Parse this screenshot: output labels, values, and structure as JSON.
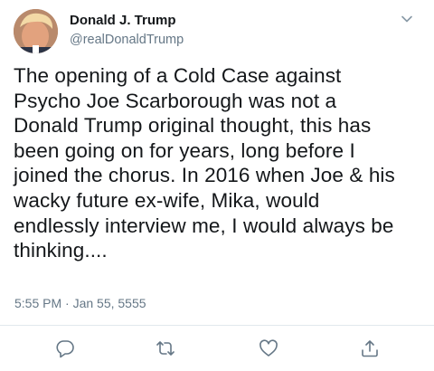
{
  "tweet": {
    "author_name": "Donald J. Trump",
    "author_handle": "@realDonaldTrump",
    "text": "The opening of a Cold Case against\nPsycho Joe Scarborough was not a\nDonald Trump original thought, this has\nbeen going on for years, long before I\njoined the chorus. In 2016 when Joe & his\nwacky future ex-wife, Mika, would\nendlessly interview me, I would always be\nthinking....",
    "timestamp": "5:55 PM · Jan 55, 5555"
  },
  "icons": {
    "more": "chevron-down-icon",
    "reply": "reply-icon",
    "retweet": "retweet-icon",
    "like": "heart-icon",
    "share": "share-icon"
  },
  "colors": {
    "text": "#14171a",
    "secondary": "#657786",
    "divider": "#e1e8ed"
  }
}
